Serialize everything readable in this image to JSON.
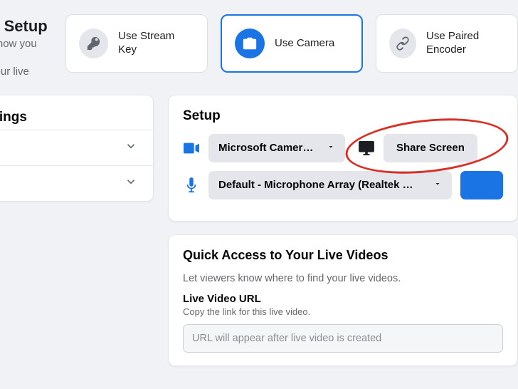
{
  "header": {
    "title": "Video Setup",
    "subtitle_line1": "Choose how you want to",
    "subtitle_line2": "set up your live"
  },
  "choices": {
    "stream_key": "Use Stream Key",
    "use_camera": "Use Camera",
    "paired_encoder": "Use Paired Encoder"
  },
  "left": {
    "title": "Settings"
  },
  "setup": {
    "title": "Setup",
    "camera_selected": "Microsoft Camer…",
    "share_screen_label": "Share Screen",
    "mic_selected": "Default - Microphone Array (Realtek …"
  },
  "quick": {
    "title": "Quick Access to Your Live Videos",
    "subtitle": "Let viewers know where to find your live videos.",
    "url_label": "Live Video URL",
    "url_hint": "Copy the link for this live video.",
    "url_placeholder": "URL will appear after live video is created"
  }
}
